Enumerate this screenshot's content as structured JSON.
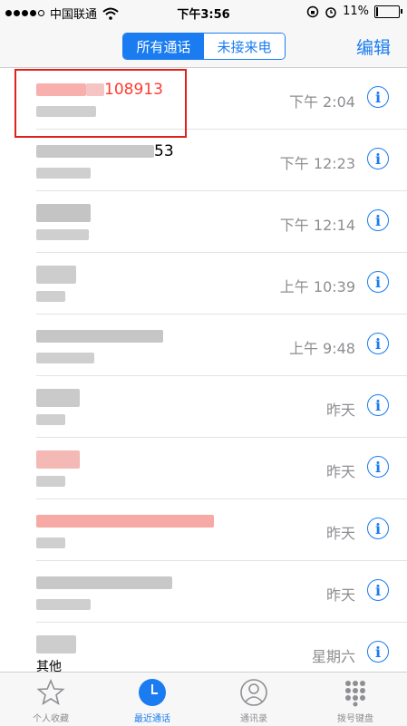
{
  "status_bar": {
    "carrier": "中国联通",
    "time": "下午3:56",
    "battery": "11%",
    "signal_filled": 4,
    "signal_total": 5,
    "battery_level": 0.11
  },
  "nav": {
    "segments": [
      "所有通话",
      "未接来电"
    ],
    "edit_label": "编辑"
  },
  "calls": [
    {
      "name_visible": "108913",
      "missed": true,
      "time": "下午 2:04"
    },
    {
      "name_visible": "53",
      "missed": false,
      "time": "下午 12:23"
    },
    {
      "name_visible": "",
      "missed": false,
      "time": "下午 12:14"
    },
    {
      "name_visible": "",
      "missed": false,
      "time": "上午 10:39"
    },
    {
      "name_visible": "",
      "missed": false,
      "time": "上午 9:48"
    },
    {
      "name_visible": "",
      "missed": false,
      "time": "昨天"
    },
    {
      "name_visible": "",
      "missed": true,
      "time": "昨天"
    },
    {
      "name_visible": "",
      "missed": true,
      "time": "昨天"
    },
    {
      "name_visible": "",
      "missed": false,
      "time": "昨天"
    },
    {
      "name_visible": "",
      "missed": false,
      "time": "星期六"
    }
  ],
  "other_label": "其他",
  "tabs": [
    {
      "label": "个人收藏",
      "icon": "star-icon",
      "active": false
    },
    {
      "label": "最近通话",
      "icon": "clock-icon",
      "active": true
    },
    {
      "label": "通讯录",
      "icon": "contacts-icon",
      "active": false
    },
    {
      "label": "拨号键盘",
      "icon": "keypad-icon",
      "active": false
    }
  ],
  "info_glyph": "i",
  "colors": {
    "accent": "#1a7cf0",
    "missed": "#ff3b30",
    "highlight": "#e0201b"
  }
}
